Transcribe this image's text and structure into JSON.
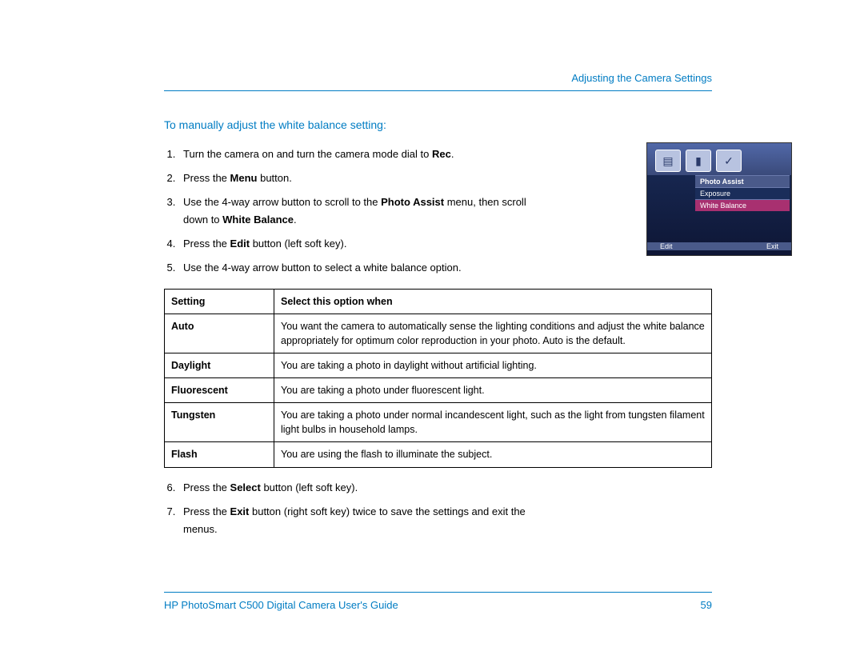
{
  "header": {
    "section": "Adjusting the Camera Settings"
  },
  "title": "To manually adjust the white balance setting:",
  "steps_a": [
    {
      "n": "1",
      "pre": "Turn the camera on and turn the camera mode dial to ",
      "b": "Rec",
      "post": "."
    },
    {
      "n": "2",
      "pre": "Press the ",
      "b": "Menu",
      "post": " button."
    },
    {
      "n": "3",
      "pre": "Use the 4-way arrow button to scroll to the ",
      "b": "Photo Assist",
      "post": " menu, then scroll down to ",
      "b2": "White Balance",
      "post2": "."
    },
    {
      "n": "4",
      "pre": "Press the ",
      "b": "Edit",
      "post": " button (left soft key)."
    },
    {
      "n": "5",
      "pre": "Use the 4-way arrow button to select a white balance option.",
      "b": "",
      "post": "",
      "wide": true
    }
  ],
  "table": {
    "h1": "Setting",
    "h2": "Select this option when",
    "rows": [
      {
        "name": "Auto",
        "desc": "You want the camera to automatically sense the lighting conditions and adjust the white balance appropriately for optimum color reproduction in your photo. Auto is the default."
      },
      {
        "name": "Daylight",
        "desc": "You are taking a photo in daylight without artificial lighting."
      },
      {
        "name": "Fluorescent",
        "desc": "You are taking a photo under fluorescent light."
      },
      {
        "name": "Tungsten",
        "desc": "You are taking a photo under normal incandescent light, such as the light from tungsten filament light bulbs in household lamps."
      },
      {
        "name": "Flash",
        "desc": "You are using the flash to illuminate the subject."
      }
    ]
  },
  "steps_b": [
    {
      "n": "6",
      "pre": "Press the ",
      "b": "Select",
      "post": " button (left soft key)."
    },
    {
      "n": "7",
      "pre": "Press the ",
      "b": "Exit",
      "post": " button (right soft key) twice to save the settings and exit the menus."
    }
  ],
  "screenshot": {
    "menu_header": "Photo Assist",
    "menu_item1": "Exposure",
    "menu_item2": "White Balance",
    "left": "Edit",
    "right": "Exit"
  },
  "footer": {
    "guide": "HP PhotoSmart C500 Digital Camera User's Guide",
    "page": "59"
  }
}
